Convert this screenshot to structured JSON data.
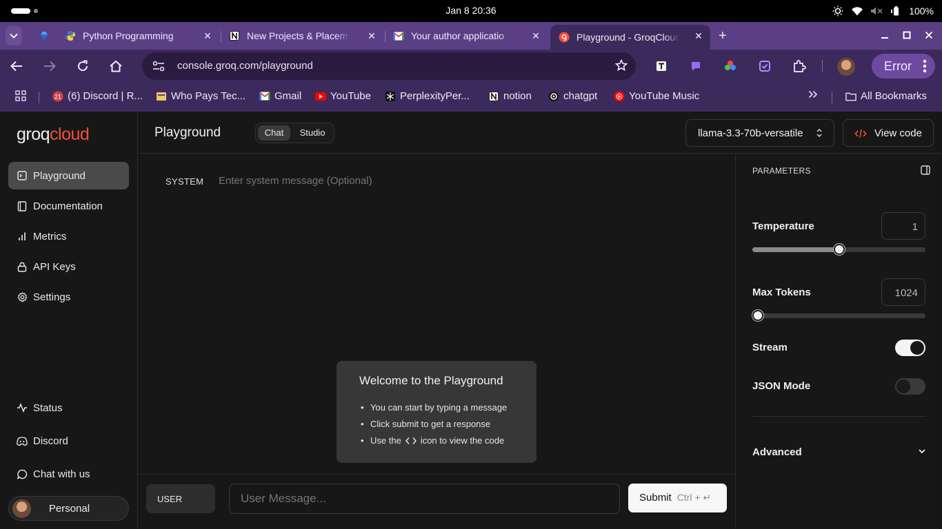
{
  "os": {
    "clock": "Jan 8  20:36",
    "battery": "100%"
  },
  "browser": {
    "tabs": [
      {
        "title": "Python Programming"
      },
      {
        "title": "New Projects & Placem"
      },
      {
        "title": "Your author applicatio"
      },
      {
        "title": "Playground - GroqCloud"
      }
    ],
    "url": "console.groq.com/playground",
    "profile_status": "Error",
    "bookmarks": [
      {
        "label": "(6) Discord | R..."
      },
      {
        "label": "Who Pays Tec..."
      },
      {
        "label": "Gmail"
      },
      {
        "label": "YouTube"
      },
      {
        "label": "PerplexityPer..."
      },
      {
        "label": "notion"
      },
      {
        "label": "chatgpt"
      },
      {
        "label": "YouTube Music"
      }
    ],
    "all_bookmarks": "All Bookmarks",
    "discord_badge": "21"
  },
  "sidebar": {
    "logo_groq": "groq",
    "logo_cloud": "cloud",
    "items": [
      {
        "label": "Playground"
      },
      {
        "label": "Documentation"
      },
      {
        "label": "Metrics"
      },
      {
        "label": "API Keys"
      },
      {
        "label": "Settings"
      }
    ],
    "footer_items": [
      {
        "label": "Status"
      },
      {
        "label": "Discord"
      },
      {
        "label": "Chat with us"
      }
    ],
    "account": "Personal"
  },
  "header": {
    "title": "Playground",
    "modes": [
      "Chat",
      "Studio"
    ],
    "active_mode": "Chat",
    "model": "llama-3.3-70b-versatile",
    "view_code": "View code"
  },
  "chat": {
    "system_label": "SYSTEM",
    "system_placeholder": "Enter system message (Optional)",
    "welcome": {
      "title": "Welcome to the Playground",
      "bullets": [
        "You can start by typing a message",
        "Click submit to get a response"
      ],
      "code_hint_prefix": "Use the",
      "code_hint_suffix": "icon to view the code"
    },
    "role": "USER",
    "message_placeholder": "User Message...",
    "submit": "Submit",
    "shortcut": "Ctrl + ↵"
  },
  "parameters": {
    "heading": "PARAMETERS",
    "temperature": {
      "label": "Temperature",
      "value": "1",
      "fraction": 0.5
    },
    "max_tokens": {
      "label": "Max Tokens",
      "value": "1024",
      "fraction": 0.03
    },
    "stream": {
      "label": "Stream",
      "on": true
    },
    "json_mode": {
      "label": "JSON Mode",
      "on": false
    },
    "advanced": "Advanced"
  },
  "colors": {
    "accent": "#f55036",
    "tab_bar": "#5a3f85",
    "toolbar": "#3d2a5c"
  }
}
